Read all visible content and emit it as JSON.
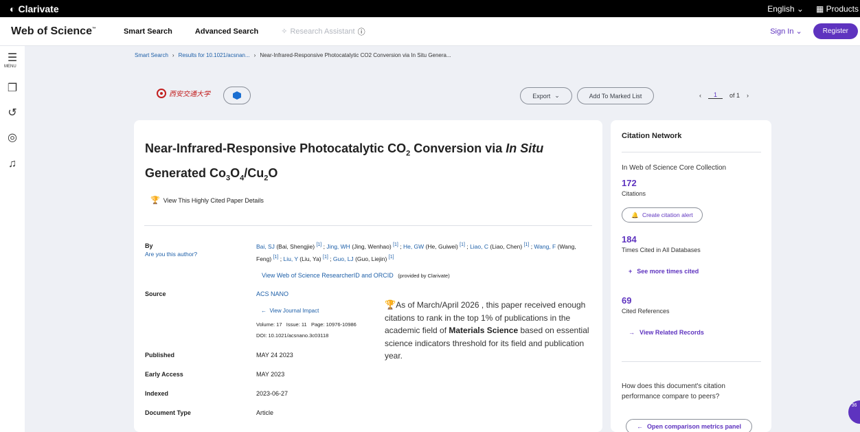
{
  "topbar": {
    "brand": "Clarivate",
    "language": "English",
    "products": "Products"
  },
  "header": {
    "product": "Web of Science",
    "tm": "™",
    "nav": [
      "Smart Search",
      "Advanced Search"
    ],
    "research_assistant": "Research Assistant",
    "sign_in": "Sign In",
    "register": "Register"
  },
  "sidebar": {
    "menu_label": "MENU"
  },
  "breadcrumb": {
    "items": [
      "Smart Search",
      "Results for 10.1021/acsnan...",
      "Near-Infrared-Responsive Photocatalytic CO2 Conversion via In Situ Genera..."
    ]
  },
  "toolbar": {
    "university_logo_text": "西安交通大学",
    "export": "Export",
    "add_marked": "Add To Marked List",
    "page_current": "1",
    "page_total": "of 1"
  },
  "record": {
    "title_parts": {
      "a": "Near-Infrared-Responsive Photocatalytic CO",
      "sub1": "2",
      "b": " Conversion via ",
      "italic": "In Situ",
      "c": "Generated Co",
      "sub2": "3",
      "d": "O",
      "sub3": "4",
      "e": "/Cu",
      "sub4": "2",
      "f": "O"
    },
    "highly_cited_link": "View This Highly Cited Paper Details",
    "by_label": "By",
    "are_you": "Are you this author?",
    "authors": [
      {
        "short": "Bai, SJ",
        "full": "(Bai, Shengjie)",
        "ref": "[1]"
      },
      {
        "short": "Jing, WH",
        "full": "(Jing, Wenhao)",
        "ref": "[1]"
      },
      {
        "short": "He, GW",
        "full": "(He, Guiwei)",
        "ref": "[1]"
      },
      {
        "short": "Liao, C",
        "full": "(Liao, Chen)",
        "ref": "[1]"
      },
      {
        "short": "Wang, F",
        "full": "(Wang, Feng)",
        "ref": "[1]"
      },
      {
        "short": "Liu, Y",
        "full": "(Liu, Ya)",
        "ref": "[1]"
      },
      {
        "short": "Guo, LJ",
        "full": "(Guo, Liejin)",
        "ref": "[1]"
      }
    ],
    "researcher_link": "View Web of Science ResearcherID and ORCID",
    "provided_by": "(provided by Clarivate)",
    "source_label": "Source",
    "source": "ACS NANO",
    "journal_impact": "View Journal Impact",
    "volume": "Volume: 17",
    "issue": "Issue: 11",
    "pages": "Page: 10976-10986",
    "doi": "DOI: 10.1021/acsnano.3c03118",
    "published_label": "Published",
    "published": "MAY 24 2023",
    "early_access_label": "Early Access",
    "early_access": "MAY 2023",
    "indexed_label": "Indexed",
    "indexed": "2023-06-27",
    "doctype_label": "Document Type",
    "doctype": "Article",
    "hc_text_1": "As of March/April 2026 , this paper received enough citations to rank in the top 1% of publications in the academic field of ",
    "hc_field": "Materials Science",
    "hc_text_2": " based on essential science indicators threshold for its field and publication year."
  },
  "citation_network": {
    "title": "Citation Network",
    "collection": "In Web of Science Core Collection",
    "citations_count": "172",
    "citations_label": "Citations",
    "create_alert": "Create citation alert",
    "all_db_count": "184",
    "all_db_label": "Times Cited in All Databases",
    "see_more": "See more times cited",
    "refs_count": "69",
    "refs_label": "Cited References",
    "related": "View Related Records",
    "compare_q": "How does this document's citation performance compare to peers?",
    "open_metrics": "Open comparison metrics panel"
  },
  "badge": {
    "count": "36"
  },
  "colors": {
    "accent": "#5e33bf",
    "link": "#1d5fa8",
    "trophy": "#c71d1d"
  }
}
